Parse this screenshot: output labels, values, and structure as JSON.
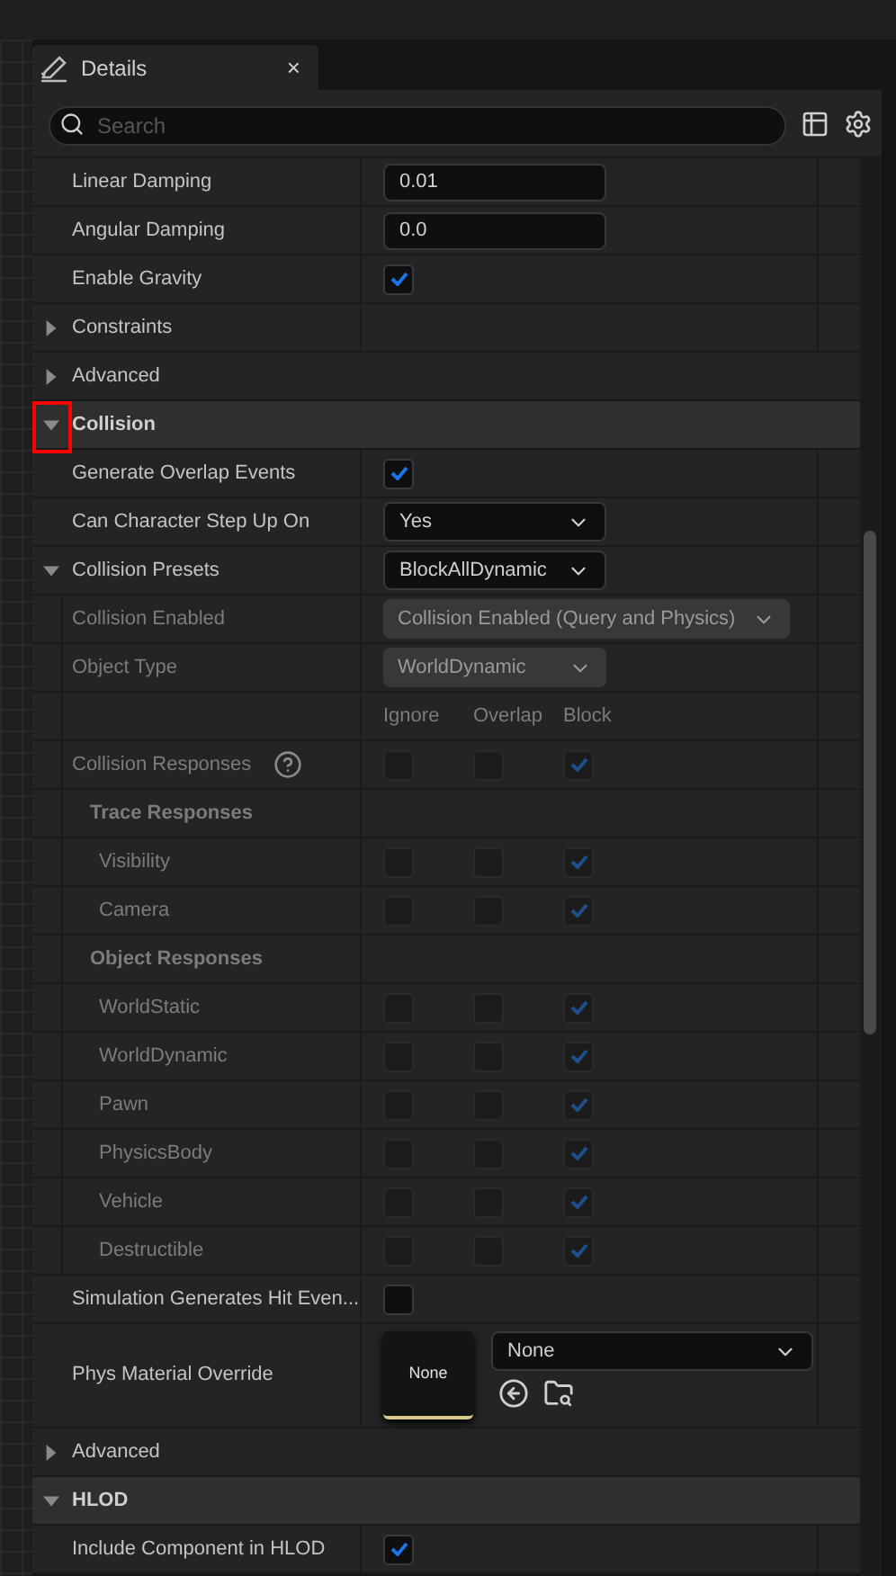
{
  "tab": {
    "title": "Details",
    "close": "×"
  },
  "search": {
    "placeholder": "Search"
  },
  "rows": [
    {
      "kind": "number",
      "label": "Linear Damping",
      "value": "0.01"
    },
    {
      "kind": "number",
      "label": "Angular Damping",
      "value": "0.0"
    },
    {
      "kind": "checkbox",
      "label": "Enable Gravity",
      "checked": true
    },
    {
      "kind": "group",
      "label": "Constraints",
      "expanded": false
    },
    {
      "kind": "advanced",
      "label": "Advanced",
      "expanded": false
    },
    {
      "kind": "category",
      "label": "Collision",
      "expanded": true,
      "highlighted": true,
      "children": [
        {
          "kind": "checkbox",
          "label": "Generate Overlap Events",
          "checked": true
        },
        {
          "kind": "dropdown",
          "label": "Can Character Step Up On",
          "value": "Yes"
        },
        {
          "kind": "group",
          "label": "Collision Presets",
          "expanded": true,
          "value": "BlockAllDynamic",
          "children": [
            {
              "kind": "dropdown",
              "label": "Collision Enabled",
              "value": "Collision Enabled (Query and Physics)",
              "disabled": true,
              "wide": true
            },
            {
              "kind": "dropdown",
              "label": "Object Type",
              "value": "WorldDynamic",
              "disabled": true
            },
            {
              "kind": "columns",
              "labels": [
                "Ignore",
                "Overlap",
                "Block"
              ]
            },
            {
              "kind": "responses",
              "label": "Collision Responses",
              "help": true,
              "disabled": true,
              "checks": [
                false,
                false,
                true
              ]
            },
            {
              "kind": "heading",
              "label": "Trace Responses",
              "children": [
                {
                  "kind": "responses",
                  "label": "Visibility",
                  "disabled": true,
                  "checks": [
                    false,
                    false,
                    true
                  ]
                },
                {
                  "kind": "responses",
                  "label": "Camera",
                  "disabled": true,
                  "checks": [
                    false,
                    false,
                    true
                  ]
                }
              ]
            },
            {
              "kind": "heading",
              "label": "Object Responses",
              "children": [
                {
                  "kind": "responses",
                  "label": "WorldStatic",
                  "disabled": true,
                  "checks": [
                    false,
                    false,
                    true
                  ]
                },
                {
                  "kind": "responses",
                  "label": "WorldDynamic",
                  "disabled": true,
                  "checks": [
                    false,
                    false,
                    true
                  ]
                },
                {
                  "kind": "responses",
                  "label": "Pawn",
                  "disabled": true,
                  "checks": [
                    false,
                    false,
                    true
                  ]
                },
                {
                  "kind": "responses",
                  "label": "PhysicsBody",
                  "disabled": true,
                  "checks": [
                    false,
                    false,
                    true
                  ]
                },
                {
                  "kind": "responses",
                  "label": "Vehicle",
                  "disabled": true,
                  "checks": [
                    false,
                    false,
                    true
                  ]
                },
                {
                  "kind": "responses",
                  "label": "Destructible",
                  "disabled": true,
                  "checks": [
                    false,
                    false,
                    true
                  ]
                }
              ]
            }
          ]
        },
        {
          "kind": "checkbox",
          "label": "Simulation Generates Hit Even...",
          "checked": false
        },
        {
          "kind": "asset",
          "label": "Phys Material Override",
          "thumbnail": "None",
          "value": "None"
        },
        {
          "kind": "advanced",
          "label": "Advanced",
          "expanded": false
        }
      ]
    },
    {
      "kind": "category",
      "label": "HLOD",
      "expanded": true,
      "children": [
        {
          "kind": "checkbox",
          "label": "Include Component in HLOD",
          "checked": true
        }
      ]
    }
  ]
}
